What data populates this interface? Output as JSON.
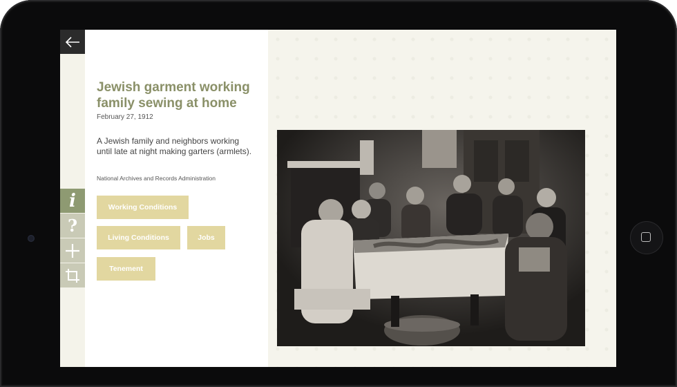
{
  "back_button": {
    "icon": "arrow-left-icon"
  },
  "tools": [
    {
      "name": "info",
      "icon": "info-icon",
      "glyph": "i",
      "active": true
    },
    {
      "name": "question",
      "icon": "question-icon",
      "glyph": "?",
      "active": false
    },
    {
      "name": "add",
      "icon": "plus-icon",
      "glyph": "+",
      "active": false
    },
    {
      "name": "crop",
      "icon": "crop-icon",
      "active": false
    }
  ],
  "info": {
    "title": "Jewish garment working family sewing at home",
    "date": "February 27, 1912",
    "description": "A Jewish family and neighbors working until late at night making garters (armlets).",
    "source": "National Archives and Records Administration",
    "tags": [
      "Working Conditions",
      "Living Conditions",
      "Jobs",
      "Tenement"
    ]
  },
  "colors": {
    "title": "#8a9068",
    "tag_bg": "#e2d7a0",
    "tool_active": "#8e9a72",
    "tool_inactive": "#c9cab6",
    "back_bg": "#2b2b2b"
  }
}
